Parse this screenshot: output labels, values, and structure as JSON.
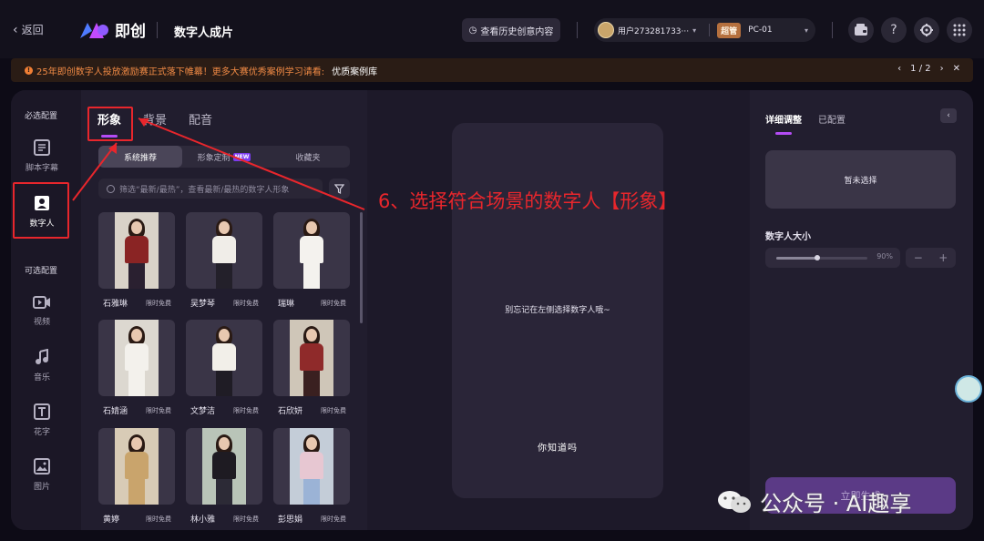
{
  "topbar": {
    "back_label": "返回",
    "brand_name": "即创",
    "page_title": "数字人成片",
    "history_button": "查看历史创意内容",
    "user_name": "用户273281733···",
    "role_badge": "超管",
    "device": "PC-01"
  },
  "notice": {
    "text": "25年即创数字人投放激励赛正式落下帷幕！更多大赛优秀案例学习请看:",
    "link": "优质案例库",
    "page": "1 / 2"
  },
  "rail": {
    "required_heading": "必选配置",
    "optional_heading": "可选配置",
    "items": [
      {
        "label": "脚本字幕",
        "icon": "script-icon"
      },
      {
        "label": "数字人",
        "icon": "digital-human-icon"
      },
      {
        "label": "视频",
        "icon": "video-icon"
      },
      {
        "label": "音乐",
        "icon": "music-icon"
      },
      {
        "label": "花字",
        "icon": "text-style-icon"
      },
      {
        "label": "图片",
        "icon": "image-icon"
      }
    ]
  },
  "assets": {
    "tabs": [
      "形象",
      "背景",
      "配音"
    ],
    "segments": [
      "系统推荐",
      "形象定制",
      "收藏夹"
    ],
    "new_badge": "NEW",
    "search_placeholder": "筛选“最新/最热”，查看最新/最热的数字人形象",
    "tag": "限时免费",
    "cards": [
      {
        "name": "石雅琳",
        "outfit": "#8a2424",
        "legs": "#2a2030",
        "bg": "#d9d2c8"
      },
      {
        "name": "吴梦琴",
        "outfit": "#f0ede8",
        "legs": "#23202a",
        "bg": "#3a3547"
      },
      {
        "name": "瑞琳",
        "outfit": "#f4f2ee",
        "legs": "#f4f2ee",
        "bg": "#3a3547"
      },
      {
        "name": "石婧涵",
        "outfit": "#f3f1ec",
        "legs": "#f3f1ec",
        "bg": "#dcd8d0"
      },
      {
        "name": "文梦洁",
        "outfit": "#f2efe9",
        "legs": "#1f1c25",
        "bg": "#3a3547"
      },
      {
        "name": "石欣妍",
        "outfit": "#8f2a2a",
        "legs": "#3a2020",
        "bg": "#cfc6b8"
      },
      {
        "name": "黄婷",
        "outfit": "#c9a46c",
        "legs": "#c9a46c",
        "bg": "#d8cbb6"
      },
      {
        "name": "林小雅",
        "outfit": "#1e1b22",
        "legs": "#2c2a36",
        "bg": "#b9c4b8"
      },
      {
        "name": "彭思娟",
        "outfit": "#e7c7d2",
        "legs": "#9bb3d6",
        "bg": "#c4cdd8"
      }
    ]
  },
  "preview": {
    "hint": "别忘记在左侧选择数字人哦~",
    "subtitle": "你知道吗"
  },
  "right": {
    "tabs": [
      "详细调整",
      "已配置"
    ],
    "empty": "暂未选择",
    "size_label": "数字人大小",
    "size_value": "90%",
    "size_fraction": 0.9,
    "generate": "立即生成"
  },
  "annotation": {
    "text": "6、选择符合场景的数字人【形象】"
  },
  "watermark": {
    "text": "公众号 · AI趣享"
  },
  "colors": {
    "accent": "#b44cf5",
    "annotation": "#e8262c",
    "notice": "#f08a45"
  }
}
